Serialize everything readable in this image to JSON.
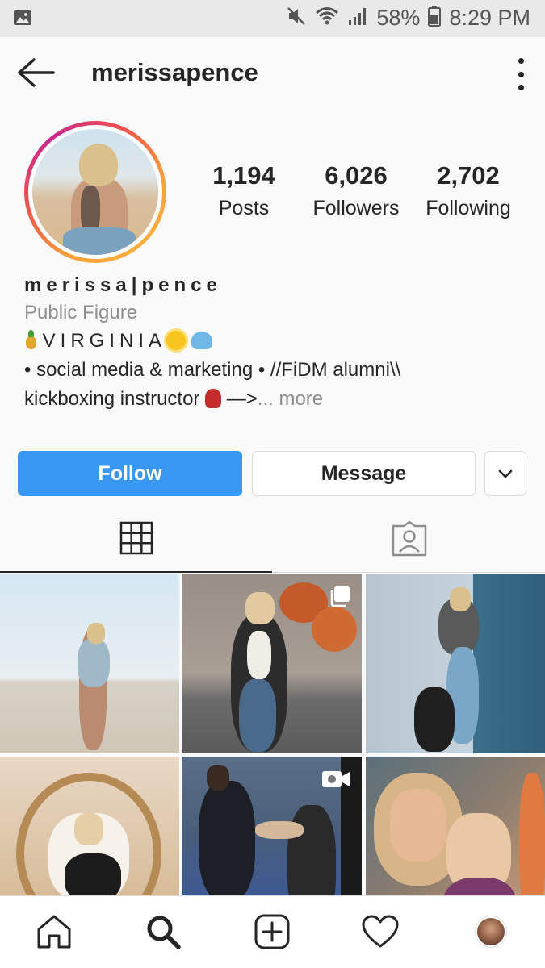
{
  "status_bar": {
    "battery": "58%",
    "time": "8:29 PM",
    "icons": [
      "image-icon",
      "mute-icon",
      "wifi-icon",
      "signal-icon",
      "battery-icon"
    ]
  },
  "header": {
    "username": "merissapence",
    "icons": [
      "back-arrow-icon",
      "more-options-icon"
    ]
  },
  "profile": {
    "stats": [
      {
        "value": "1,194",
        "label": "Posts"
      },
      {
        "value": "6,026",
        "label": "Followers"
      },
      {
        "value": "2,702",
        "label": "Following"
      }
    ],
    "full_name": "merissa|pence",
    "category": "Public Figure",
    "bio_line1": "VIRGINIA",
    "bio_line2": "• social media & marketing • //FiDM alumni\\\\",
    "bio_line3": "kickboxing instructor",
    "bio_line3_tail": " —>",
    "more": "... more",
    "emojis": [
      "pineapple-icon",
      "sun-icon",
      "wave-icon",
      "boxing-glove-icon"
    ]
  },
  "actions": {
    "follow": "Follow",
    "message": "Message",
    "dropdown_icon": "chevron-down-icon"
  },
  "tabs": [
    "grid-icon",
    "tagged-icon"
  ],
  "posts": [
    {
      "id": 1,
      "overlay": ""
    },
    {
      "id": 2,
      "overlay": "carousel-icon"
    },
    {
      "id": 3,
      "overlay": ""
    },
    {
      "id": 4,
      "overlay": ""
    },
    {
      "id": 5,
      "overlay": "video-icon"
    },
    {
      "id": 6,
      "overlay": ""
    }
  ],
  "bottom_nav": [
    "home-icon",
    "search-icon",
    "new-post-icon",
    "activity-heart-icon",
    "profile-avatar"
  ],
  "colors": {
    "follow_button": "#3897f0",
    "ring_gradient": [
      "#f9a23a",
      "#ee4f4f",
      "#c8288f"
    ],
    "muted_text": "#8e8e8e"
  }
}
